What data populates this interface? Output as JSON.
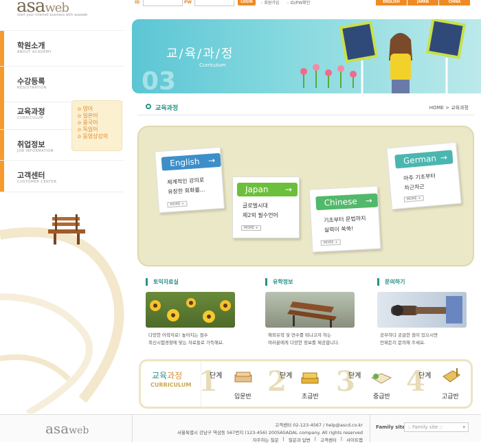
{
  "header": {
    "logo_main": "asa",
    "logo_web": "web",
    "tagline": "start your internet business with asaweb",
    "id_label": "ID",
    "pw_label": "PW",
    "login_label": "LOGIN",
    "join_label": "회원가입",
    "find_label": "ID/PW확인",
    "languages": [
      "ENGLISH",
      "JAPAN",
      "CHINA"
    ]
  },
  "sidebar": {
    "items": [
      {
        "ko": "학원소개",
        "en": "ABOUT ACADEMY"
      },
      {
        "ko": "수강등록",
        "en": "REGISTRATION"
      },
      {
        "ko": "교육과정",
        "en": "CURRICULUM"
      },
      {
        "ko": "취업정보",
        "en": "JOB INFORMATION"
      },
      {
        "ko": "고객센터",
        "en": "CUSTOMER CENTER"
      }
    ],
    "submenu": [
      "영어",
      "일본어",
      "중국어",
      "독일어",
      "동영상강의"
    ]
  },
  "banner": {
    "title": "교/육/과/정",
    "subtitle": "Curriculum",
    "number": "03"
  },
  "breadcrumb": {
    "title": "교육과정",
    "path": "HOME > 교육과정"
  },
  "courses": [
    {
      "name": "English",
      "line1": "체계적인 강의로",
      "line2": "유창한 회화를...",
      "more": "MORE +",
      "color": "#3d8fc9"
    },
    {
      "name": "Japan",
      "line1": "글로벌시대",
      "line2": "제2외 필수언어",
      "more": "MORE +",
      "color": "#6cbf3a"
    },
    {
      "name": "Chinese",
      "line1": "기초부터 문법까지",
      "line2": "실력이 쑥쑥!",
      "more": "MORE +",
      "color": "#52b86a"
    },
    {
      "name": "German",
      "line1": "아주 기초부터",
      "line2": "차근차근",
      "more": "MORE +",
      "color": "#4ab6b0"
    }
  ],
  "sections": [
    {
      "title": "토익자료실",
      "desc1": "다양한 어학자료! 높아지는 점수",
      "desc2": "최신시험경향에 맞는 자료들로 가득해요."
    },
    {
      "title": "유학정보",
      "desc1": "해외유학 및 연수를 떠나고자 하는",
      "desc2": "여러분에게 다양한 정보를 제공합니다."
    },
    {
      "title": "문의하기",
      "desc1": "공부하다 궁금한 점이 있으시면",
      "desc2": "언제든지 문의해 주세요."
    }
  ],
  "steps": {
    "title_ko_a": "교육",
    "title_ko_b": "과정",
    "title_en": "CURRICULUM",
    "unit": "단계",
    "items": [
      {
        "num": "1",
        "name": "입문반"
      },
      {
        "num": "2",
        "name": "초급반"
      },
      {
        "num": "3",
        "name": "중급반"
      },
      {
        "num": "4",
        "name": "고급반"
      }
    ]
  },
  "footer": {
    "logo_main": "asa",
    "logo_web": "web",
    "contact": "고객센터 02-123-4567 / help@ascd.co.kr",
    "address": "서울특별시 강남구 역삼동 567번지 (123-456) 2005ASADAL company. All rights reserved",
    "links": [
      "자주하는 질문",
      "질문과 답변",
      "고객센터",
      "사이트맵"
    ],
    "family_label": "Family site",
    "family_value": ":: Family site ::"
  },
  "colors": {
    "accent_orange": "#f08a24",
    "accent_teal": "#2a8f86"
  }
}
